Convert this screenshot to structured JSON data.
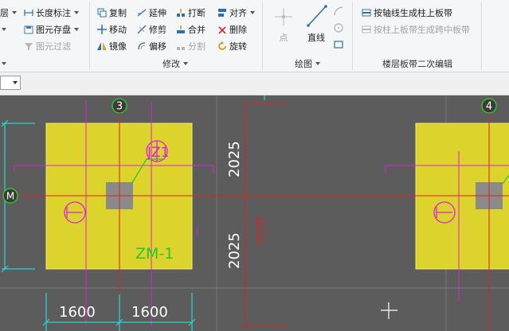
{
  "ribbon": {
    "col1": {
      "layer_label": "层",
      "layer_caret": "▾"
    },
    "col2": {
      "dimension_label": "长度标注",
      "save_label": "图元存盘",
      "filter_label": "图元过滤"
    },
    "modify": {
      "copy": "复制",
      "extend": "延伸",
      "break": "打断",
      "align": "对齐",
      "move": "移动",
      "trim": "修剪",
      "merge": "合并",
      "delete": "删除",
      "mirror": "镜像",
      "offset": "偏移",
      "split": "分割",
      "rotate": "旋转",
      "group_label": "修改"
    },
    "draw": {
      "point": "点",
      "line": "直线",
      "group_label": "绘图"
    },
    "strip": {
      "gen_column_strip": "按轴线生成柱上板带",
      "gen_middle_strip": "按柱上板带生成跨中板带",
      "group_label": "楼层板带二次编辑"
    }
  },
  "canvas": {
    "axis_labels": [
      "3",
      "4",
      "M"
    ],
    "dims": {
      "left": "1600",
      "right": "1600",
      "upper": "2025",
      "lower": "2025"
    },
    "column_tag": "JZ1",
    "footing_label": "ZM-1",
    "colors": {
      "background": "#5c5c5c",
      "footing": "#dcd42c",
      "axis": "#e02020",
      "dimension": "#27d6d6",
      "magenta": "#dd22dd",
      "green": "#2bc42b",
      "column": "#8a8a8a"
    }
  }
}
